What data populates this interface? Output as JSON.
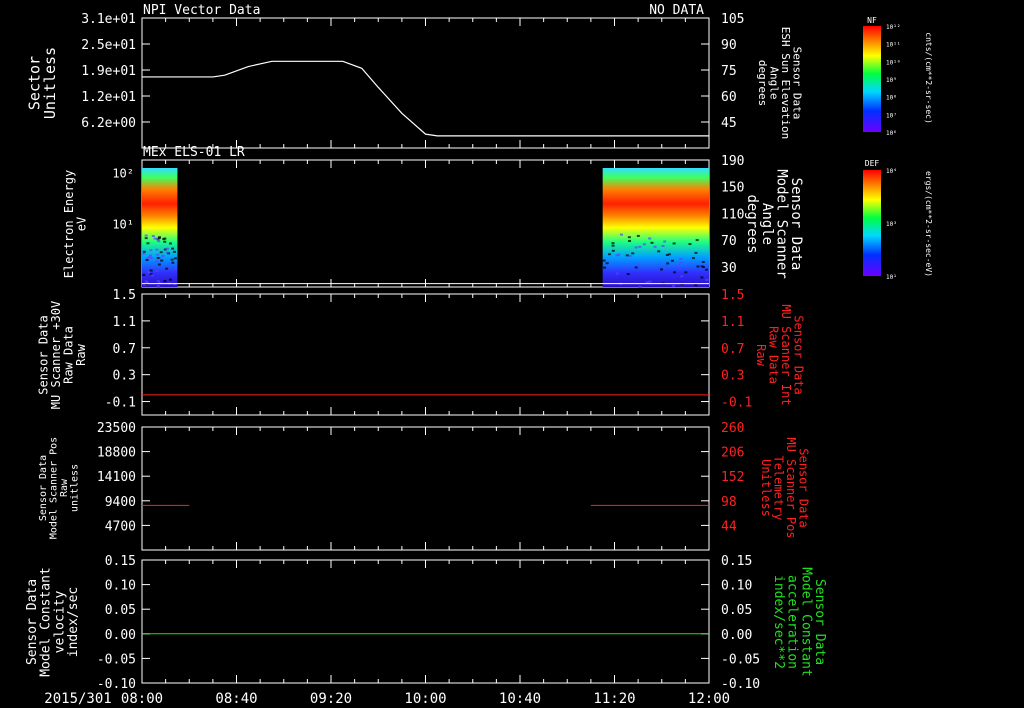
{
  "colors": {
    "white": "#ffffff",
    "red": "#ff2020",
    "green": "#20e020",
    "background": "#000000"
  },
  "time_axis": {
    "date_label": "2015/301",
    "ticks": [
      "08:00",
      "08:40",
      "09:20",
      "10:00",
      "10:40",
      "11:20",
      "12:00"
    ]
  },
  "chart_data": [
    {
      "type": "line",
      "title": "NPI Vector Data",
      "status": "NO DATA",
      "ylabel_left": [
        "Sector",
        "Unitless"
      ],
      "ylabel_right": [
        "Sensor Data",
        "ESH Sun Elevation",
        "Angle",
        "degrees"
      ],
      "yticks_left": [
        "3.1e+01",
        "2.5e+01",
        "1.9e+01",
        "1.2e+01",
        "6.2e+00"
      ],
      "yticks_right": [
        "105",
        "90",
        "75",
        "60",
        "45"
      ],
      "ylim_right": [
        30,
        105
      ],
      "series": [
        {
          "x": [
            "08:00",
            "08:30",
            "08:35",
            "08:45",
            "08:55",
            "09:10",
            "09:25",
            "09:33",
            "09:40",
            "09:50",
            "10:00",
            "10:05",
            "12:00"
          ],
          "y": [
            71,
            71,
            72,
            77,
            80,
            80,
            80,
            76,
            65,
            50,
            38,
            37,
            37
          ]
        }
      ]
    },
    {
      "type": "heatmap",
      "title": "MEx ELS-01 LR",
      "ylabel_left": [
        "Electron Energy",
        "eV"
      ],
      "ylabel_right": [
        "Sensor Data",
        "Model Scanner",
        "Angle",
        "degrees"
      ],
      "yticks_left": [
        "10²",
        "10¹"
      ],
      "yticks_right": [
        "190",
        "150",
        "110",
        "70",
        "30"
      ],
      "ylim_right": [
        0,
        190
      ],
      "data_intervals": [
        [
          "08:00",
          "08:15"
        ],
        [
          "11:15",
          "12:00"
        ]
      ],
      "overlay_line": {
        "x": [
          "08:00",
          "12:00"
        ],
        "y": [
          5,
          5
        ]
      },
      "colorbar": {
        "label": "DEF",
        "unit": "ergs/(cm**2-sr-sec-eV)",
        "ticks": [
          "10⁴",
          "10³",
          "10¹"
        ]
      }
    },
    {
      "type": "line",
      "ylabel_left": [
        "Sensor Data",
        "MU Scanner +30V",
        "Raw Data",
        "Raw"
      ],
      "ylabel_right": [
        "Sensor Data",
        "MU Scanner Int",
        "Raw Data",
        "Raw"
      ],
      "yticks_left": [
        "1.5",
        "1.1",
        "0.7",
        "0.3",
        "-0.1"
      ],
      "yticks_right": [
        "1.5",
        "1.1",
        "0.7",
        "0.3",
        "-0.1"
      ],
      "ylim": [
        -0.3,
        1.5
      ],
      "series": [
        {
          "x": [
            "08:00",
            "12:00"
          ],
          "y": [
            0.0,
            0.0
          ]
        }
      ]
    },
    {
      "type": "line",
      "ylabel_left": [
        "Sensor Data",
        "Model Scanner Pos",
        "Raw",
        "unitless"
      ],
      "ylabel_right": [
        "Sensor Data",
        "MU Scanner Pos",
        "Telemetry",
        "Unitless"
      ],
      "yticks_left": [
        "23500",
        "18800",
        "14100",
        "9400",
        "4700"
      ],
      "yticks_right": [
        "260",
        "206",
        "152",
        "98",
        "44"
      ],
      "ylim_right": [
        -10,
        260
      ],
      "series": [
        {
          "x": [
            "08:00",
            "08:20"
          ],
          "y": [
            88,
            88
          ]
        },
        {
          "x": [
            "11:10",
            "12:00"
          ],
          "y": [
            88,
            88
          ]
        }
      ]
    },
    {
      "type": "line",
      "ylabel_left": [
        "Sensor Data",
        "Model Constant",
        "velocity",
        "index/sec"
      ],
      "ylabel_right": [
        "Sensor Data",
        "Model Constant",
        "acceleration",
        "index/sec**2"
      ],
      "yticks_left": [
        "0.15",
        "0.10",
        "0.05",
        "0.00",
        "-0.05",
        "-0.10"
      ],
      "yticks_right": [
        "0.15",
        "0.10",
        "0.05",
        "0.00",
        "-0.05",
        "-0.10"
      ],
      "ylim": [
        -0.1,
        0.15
      ],
      "series": [
        {
          "x": [
            "08:00",
            "12:00"
          ],
          "y": [
            0.0,
            0.0
          ]
        }
      ]
    }
  ],
  "colorbar_top": {
    "label": "NF",
    "unit": "cnts/(cm**2-sr-sec)",
    "ticks": [
      "10¹²",
      "10¹¹",
      "10¹⁰",
      "10⁹",
      "10⁸",
      "10⁷",
      "10⁶"
    ]
  }
}
